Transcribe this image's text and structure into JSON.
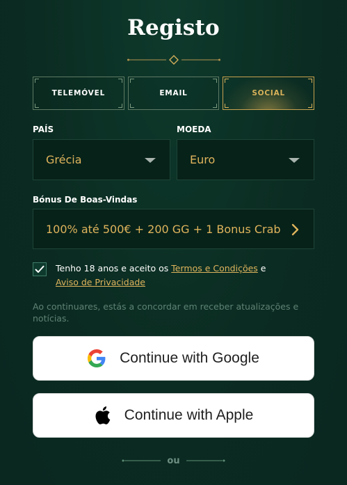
{
  "title": "Registo",
  "tabs": [
    {
      "label": "TELEMÓVEL",
      "active": false
    },
    {
      "label": "EMAIL",
      "active": false
    },
    {
      "label": "SOCIAL",
      "active": true
    }
  ],
  "country": {
    "label": "PAÍS",
    "value": "Grécia",
    "icon": "caret-down-icon"
  },
  "currency": {
    "label": "MOEDA",
    "value": "Euro",
    "icon": "caret-down-icon"
  },
  "bonus": {
    "label": "Bónus De Boas-Vindas",
    "value": "100% até 500€ + 200 GG + 1 Bonus Crab",
    "icon": "chevron-right-icon"
  },
  "consent": {
    "checked": true,
    "prefix": "Tenho 18 anos e aceito os ",
    "terms_link": "Termos e Condições",
    "conjunction": " e",
    "privacy_link": "Aviso de Privacidade"
  },
  "notice": "Ao continuares, estás a concordar em receber atualizações e notícias.",
  "buttons": {
    "google": {
      "label": "Continue with Google",
      "icon": "google-icon"
    },
    "apple": {
      "label": "Continue with Apple",
      "icon": "apple-icon"
    }
  },
  "divider_text": "ou",
  "colors": {
    "background": "#0b2c22",
    "accent_gold": "#dfb45c",
    "field_bg": "#072219",
    "muted_text": "#5f8375"
  }
}
